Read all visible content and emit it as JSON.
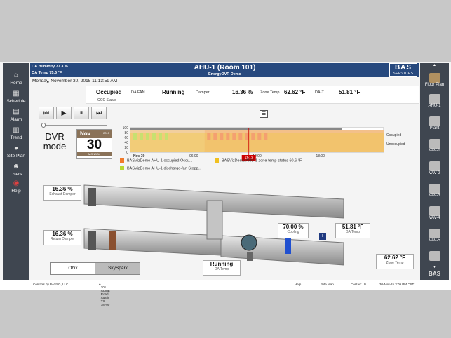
{
  "sidebar_left": [
    {
      "label": "Home",
      "icon": "home-icon"
    },
    {
      "label": "Schedule",
      "icon": "schedule-icon"
    },
    {
      "label": "Alarm",
      "icon": "alarm-icon"
    },
    {
      "label": "Trend",
      "icon": "trend-icon"
    },
    {
      "label": "Site Plan",
      "icon": "globe-icon"
    },
    {
      "label": "Users",
      "icon": "users-icon"
    },
    {
      "label": "Help",
      "icon": "help-icon"
    }
  ],
  "header": {
    "oa_humidity": "OA Humidity 77.3 %",
    "oa_temp": "OA Temp  75.6 °F",
    "title": "AHU-1 (Room 101)",
    "subtitle": "EnergyDVR Demo"
  },
  "brand": {
    "name": "BAS",
    "sub": "SERVICES"
  },
  "datetime": "Monday, November 30, 2015 11:13:59 AM",
  "status": {
    "occ_value": "Occupied",
    "occ_label": "OCC Status",
    "fan_label": "DA FAN",
    "fan_value": "Running",
    "damper_label": "Damper",
    "damper_value": "16.36 %",
    "zone_label": "Zone Temp",
    "zone_value": "62.62 °F",
    "dat_label": "DA-T",
    "dat_value": "51.81 °F"
  },
  "dvr": {
    "line1": "DVR",
    "line2": "mode"
  },
  "calendar": {
    "month": "Nov",
    "year": "2015",
    "day": "30",
    "weekday": "MONDAY"
  },
  "chart_data": {
    "type": "area",
    "y_ticks": [
      "100",
      "80",
      "60",
      "40",
      "20",
      "0"
    ],
    "x_ticks": [
      "Nov 30",
      "06:00",
      "12:00",
      "18:00"
    ],
    "cursor_label": "11:13",
    "right_labels": [
      "Occupied",
      "Unoccupied"
    ],
    "occupied_window": [
      "07:00",
      "24:00"
    ],
    "series": [
      {
        "name": "BASVizDemo AHU-1 occupied  Occu...",
        "color": "#f07a2a"
      },
      {
        "name": "BASVizDemo AHU-1 zone-temp-status  60.6 °F",
        "color": "#f0c020"
      },
      {
        "name": "BASVizDemo AHU-1 discharge-fan  Stopp...",
        "color": "#b8d830"
      }
    ]
  },
  "diagram": {
    "exhaust_damper_value": "16.36 %",
    "exhaust_damper_label": "Exhaust Damper",
    "return_damper_value": "16.36 %",
    "return_damper_label": "Return Damper",
    "cooling_value": "70.00 %",
    "cooling_label": "Cooling",
    "da_temp_value": "51.81 °F",
    "da_temp_label": "DA Temp",
    "fan_value": "Running",
    "fan_label": "DA Temp",
    "zone_temp_value": "62.62 °F",
    "zone_temp_label": "Zone Temp",
    "sensor_letter": "T"
  },
  "toggle": {
    "left": "Obix",
    "right": "SkySpark"
  },
  "sidebar_right": [
    {
      "label": "Floor Plan"
    },
    {
      "label": "AHU-1"
    },
    {
      "label": "Plant"
    },
    {
      "label": "VAV-1"
    },
    {
      "label": "VAV-2"
    },
    {
      "label": "VAV-3"
    },
    {
      "label": "VAV-4"
    },
    {
      "label": "VAV-5"
    },
    {
      "label": ""
    }
  ],
  "right_brand": "BAS",
  "footer": {
    "left": "Controls by BASSG, LLC.",
    "address": "101 ACME Road, Austin TX 78700",
    "help": "Help",
    "sitemap": "Site Map",
    "contact": "Contact Us",
    "timestamp": "30-Nov-15 3:09 PM CST"
  }
}
